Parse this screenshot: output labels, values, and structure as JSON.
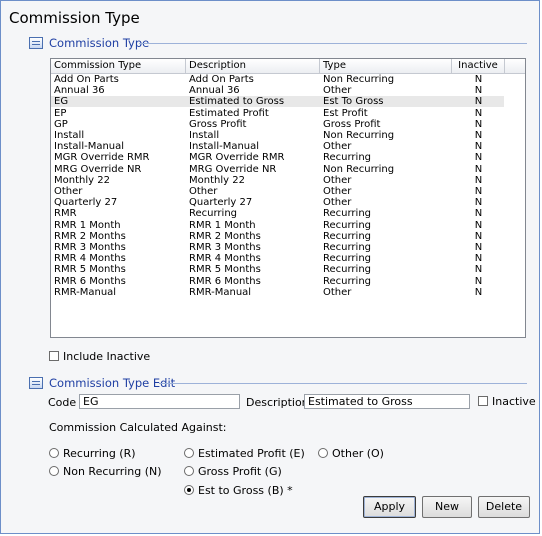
{
  "window": {
    "title": "Commission Type"
  },
  "list_section": {
    "label": "Commission Type",
    "icon": "list-form-icon",
    "columns": [
      "Commission Type",
      "Description",
      "Type",
      "Inactive"
    ],
    "rows": [
      {
        "type": "Add On Parts",
        "description": "Add On Parts",
        "kind": "Non Recurring",
        "inactive": "N"
      },
      {
        "type": "Annual 36",
        "description": "Annual 36",
        "kind": "Other",
        "inactive": "N"
      },
      {
        "type": "EG",
        "description": "Estimated to Gross",
        "kind": "Est To Gross",
        "inactive": "N"
      },
      {
        "type": "EP",
        "description": "Estimated Profit",
        "kind": "Est Profit",
        "inactive": "N"
      },
      {
        "type": "GP",
        "description": "Gross Profit",
        "kind": "Gross Profit",
        "inactive": "N"
      },
      {
        "type": "Install",
        "description": "Install",
        "kind": "Non Recurring",
        "inactive": "N"
      },
      {
        "type": "Install-Manual",
        "description": "Install-Manual",
        "kind": "Other",
        "inactive": "N"
      },
      {
        "type": "MGR Override RMR",
        "description": "MGR Override RMR",
        "kind": "Recurring",
        "inactive": "N"
      },
      {
        "type": "MRG Override NR",
        "description": "MRG Override NR",
        "kind": "Non Recurring",
        "inactive": "N"
      },
      {
        "type": "Monthly 22",
        "description": "Monthly 22",
        "kind": "Other",
        "inactive": "N"
      },
      {
        "type": "Other",
        "description": "Other",
        "kind": "Other",
        "inactive": "N"
      },
      {
        "type": "Quarterly 27",
        "description": "Quarterly 27",
        "kind": "Other",
        "inactive": "N"
      },
      {
        "type": "RMR",
        "description": "Recurring",
        "kind": "Recurring",
        "inactive": "N"
      },
      {
        "type": "RMR 1 Month",
        "description": "RMR 1 Month",
        "kind": "Recurring",
        "inactive": "N"
      },
      {
        "type": "RMR 2 Months",
        "description": "RMR 2 Months",
        "kind": "Recurring",
        "inactive": "N"
      },
      {
        "type": "RMR 3 Months",
        "description": "RMR 3 Months",
        "kind": "Recurring",
        "inactive": "N"
      },
      {
        "type": "RMR 4 Months",
        "description": "RMR 4 Months",
        "kind": "Recurring",
        "inactive": "N"
      },
      {
        "type": "RMR 5 Months",
        "description": "RMR 5 Months",
        "kind": "Recurring",
        "inactive": "N"
      },
      {
        "type": "RMR 6 Months",
        "description": "RMR 6 Months",
        "kind": "Recurring",
        "inactive": "N"
      },
      {
        "type": "RMR-Manual",
        "description": "RMR-Manual",
        "kind": "Other",
        "inactive": "N"
      }
    ],
    "selected_index": 2,
    "include_inactive_label": "Include Inactive",
    "include_inactive_checked": false
  },
  "edit_section": {
    "label": "Commission Type Edit",
    "icon": "edit-form-icon",
    "code_label": "Code",
    "code_value": "EG",
    "description_label": "Description",
    "description_value": "Estimated to Gross",
    "inactive_label": "Inactive",
    "inactive_checked": false,
    "calc_label": "Commission Calculated Against:",
    "options": [
      {
        "label": "Recurring (R)",
        "selected": false
      },
      {
        "label": "Non Recurring (N)",
        "selected": false
      },
      {
        "label": "Estimated Profit (E)",
        "selected": false
      },
      {
        "label": "Gross Profit (G)",
        "selected": false
      },
      {
        "label": "Est to Gross (B) *",
        "selected": true
      },
      {
        "label": "Other (O)",
        "selected": false
      }
    ]
  },
  "buttons": {
    "apply": "Apply",
    "new": "New",
    "delete": "Delete"
  }
}
